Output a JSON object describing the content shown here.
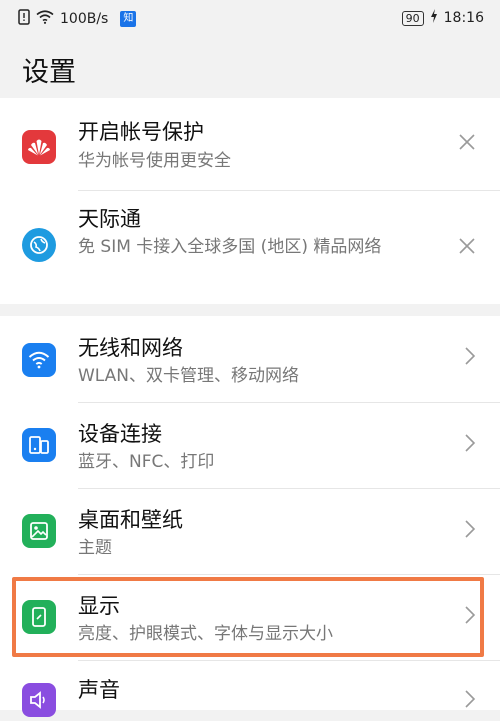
{
  "status_bar": {
    "speed": "100B/s",
    "app_badge": "知",
    "battery": "90",
    "time": "18:16"
  },
  "page_title": "设置",
  "items": [
    {
      "title": "开启帐号保护",
      "subtitle": "华为帐号使用更安全"
    },
    {
      "title": "天际通",
      "subtitle": "免 SIM 卡接入全球多国 (地区) 精品网络"
    },
    {
      "title": "无线和网络",
      "subtitle": "WLAN、双卡管理、移动网络"
    },
    {
      "title": "设备连接",
      "subtitle": "蓝牙、NFC、打印"
    },
    {
      "title": "桌面和壁纸",
      "subtitle": "主题"
    },
    {
      "title": "显示",
      "subtitle": "亮度、护眼模式、字体与显示大小"
    },
    {
      "title": "声音",
      "subtitle": ""
    }
  ],
  "icons": {
    "huawei": "huawei-logo-icon",
    "skytone": "globe-icon",
    "wifi": "wifi-icon",
    "device": "device-connection-icon",
    "wallpaper": "wallpaper-icon",
    "display": "display-icon",
    "sound": "speaker-icon"
  },
  "colors": {
    "highlight": "#f07a45"
  }
}
